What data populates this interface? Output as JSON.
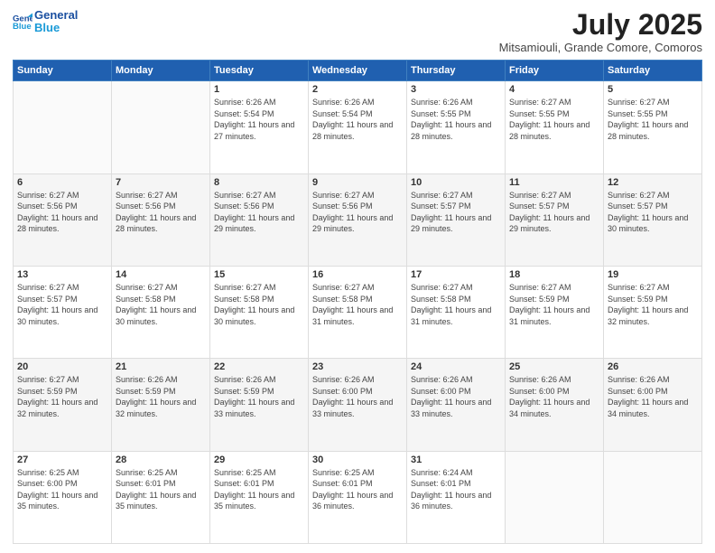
{
  "header": {
    "logo_line1": "General",
    "logo_line2": "Blue",
    "title": "July 2025",
    "subtitle": "Mitsamiouli, Grande Comore, Comoros"
  },
  "days_of_week": [
    "Sunday",
    "Monday",
    "Tuesday",
    "Wednesday",
    "Thursday",
    "Friday",
    "Saturday"
  ],
  "weeks": [
    [
      {
        "day": null
      },
      {
        "day": null
      },
      {
        "day": 1,
        "sunrise": "Sunrise: 6:26 AM",
        "sunset": "Sunset: 5:54 PM",
        "daylight": "Daylight: 11 hours and 27 minutes."
      },
      {
        "day": 2,
        "sunrise": "Sunrise: 6:26 AM",
        "sunset": "Sunset: 5:54 PM",
        "daylight": "Daylight: 11 hours and 28 minutes."
      },
      {
        "day": 3,
        "sunrise": "Sunrise: 6:26 AM",
        "sunset": "Sunset: 5:55 PM",
        "daylight": "Daylight: 11 hours and 28 minutes."
      },
      {
        "day": 4,
        "sunrise": "Sunrise: 6:27 AM",
        "sunset": "Sunset: 5:55 PM",
        "daylight": "Daylight: 11 hours and 28 minutes."
      },
      {
        "day": 5,
        "sunrise": "Sunrise: 6:27 AM",
        "sunset": "Sunset: 5:55 PM",
        "daylight": "Daylight: 11 hours and 28 minutes."
      }
    ],
    [
      {
        "day": 6,
        "sunrise": "Sunrise: 6:27 AM",
        "sunset": "Sunset: 5:56 PM",
        "daylight": "Daylight: 11 hours and 28 minutes."
      },
      {
        "day": 7,
        "sunrise": "Sunrise: 6:27 AM",
        "sunset": "Sunset: 5:56 PM",
        "daylight": "Daylight: 11 hours and 28 minutes."
      },
      {
        "day": 8,
        "sunrise": "Sunrise: 6:27 AM",
        "sunset": "Sunset: 5:56 PM",
        "daylight": "Daylight: 11 hours and 29 minutes."
      },
      {
        "day": 9,
        "sunrise": "Sunrise: 6:27 AM",
        "sunset": "Sunset: 5:56 PM",
        "daylight": "Daylight: 11 hours and 29 minutes."
      },
      {
        "day": 10,
        "sunrise": "Sunrise: 6:27 AM",
        "sunset": "Sunset: 5:57 PM",
        "daylight": "Daylight: 11 hours and 29 minutes."
      },
      {
        "day": 11,
        "sunrise": "Sunrise: 6:27 AM",
        "sunset": "Sunset: 5:57 PM",
        "daylight": "Daylight: 11 hours and 29 minutes."
      },
      {
        "day": 12,
        "sunrise": "Sunrise: 6:27 AM",
        "sunset": "Sunset: 5:57 PM",
        "daylight": "Daylight: 11 hours and 30 minutes."
      }
    ],
    [
      {
        "day": 13,
        "sunrise": "Sunrise: 6:27 AM",
        "sunset": "Sunset: 5:57 PM",
        "daylight": "Daylight: 11 hours and 30 minutes."
      },
      {
        "day": 14,
        "sunrise": "Sunrise: 6:27 AM",
        "sunset": "Sunset: 5:58 PM",
        "daylight": "Daylight: 11 hours and 30 minutes."
      },
      {
        "day": 15,
        "sunrise": "Sunrise: 6:27 AM",
        "sunset": "Sunset: 5:58 PM",
        "daylight": "Daylight: 11 hours and 30 minutes."
      },
      {
        "day": 16,
        "sunrise": "Sunrise: 6:27 AM",
        "sunset": "Sunset: 5:58 PM",
        "daylight": "Daylight: 11 hours and 31 minutes."
      },
      {
        "day": 17,
        "sunrise": "Sunrise: 6:27 AM",
        "sunset": "Sunset: 5:58 PM",
        "daylight": "Daylight: 11 hours and 31 minutes."
      },
      {
        "day": 18,
        "sunrise": "Sunrise: 6:27 AM",
        "sunset": "Sunset: 5:59 PM",
        "daylight": "Daylight: 11 hours and 31 minutes."
      },
      {
        "day": 19,
        "sunrise": "Sunrise: 6:27 AM",
        "sunset": "Sunset: 5:59 PM",
        "daylight": "Daylight: 11 hours and 32 minutes."
      }
    ],
    [
      {
        "day": 20,
        "sunrise": "Sunrise: 6:27 AM",
        "sunset": "Sunset: 5:59 PM",
        "daylight": "Daylight: 11 hours and 32 minutes."
      },
      {
        "day": 21,
        "sunrise": "Sunrise: 6:26 AM",
        "sunset": "Sunset: 5:59 PM",
        "daylight": "Daylight: 11 hours and 32 minutes."
      },
      {
        "day": 22,
        "sunrise": "Sunrise: 6:26 AM",
        "sunset": "Sunset: 5:59 PM",
        "daylight": "Daylight: 11 hours and 33 minutes."
      },
      {
        "day": 23,
        "sunrise": "Sunrise: 6:26 AM",
        "sunset": "Sunset: 6:00 PM",
        "daylight": "Daylight: 11 hours and 33 minutes."
      },
      {
        "day": 24,
        "sunrise": "Sunrise: 6:26 AM",
        "sunset": "Sunset: 6:00 PM",
        "daylight": "Daylight: 11 hours and 33 minutes."
      },
      {
        "day": 25,
        "sunrise": "Sunrise: 6:26 AM",
        "sunset": "Sunset: 6:00 PM",
        "daylight": "Daylight: 11 hours and 34 minutes."
      },
      {
        "day": 26,
        "sunrise": "Sunrise: 6:26 AM",
        "sunset": "Sunset: 6:00 PM",
        "daylight": "Daylight: 11 hours and 34 minutes."
      }
    ],
    [
      {
        "day": 27,
        "sunrise": "Sunrise: 6:25 AM",
        "sunset": "Sunset: 6:00 PM",
        "daylight": "Daylight: 11 hours and 35 minutes."
      },
      {
        "day": 28,
        "sunrise": "Sunrise: 6:25 AM",
        "sunset": "Sunset: 6:01 PM",
        "daylight": "Daylight: 11 hours and 35 minutes."
      },
      {
        "day": 29,
        "sunrise": "Sunrise: 6:25 AM",
        "sunset": "Sunset: 6:01 PM",
        "daylight": "Daylight: 11 hours and 35 minutes."
      },
      {
        "day": 30,
        "sunrise": "Sunrise: 6:25 AM",
        "sunset": "Sunset: 6:01 PM",
        "daylight": "Daylight: 11 hours and 36 minutes."
      },
      {
        "day": 31,
        "sunrise": "Sunrise: 6:24 AM",
        "sunset": "Sunset: 6:01 PM",
        "daylight": "Daylight: 11 hours and 36 minutes."
      },
      {
        "day": null
      },
      {
        "day": null
      }
    ]
  ]
}
